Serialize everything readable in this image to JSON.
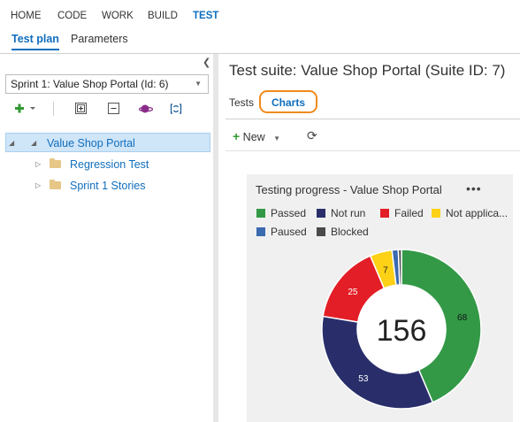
{
  "topnav": [
    "HOME",
    "CODE",
    "WORK",
    "BUILD",
    "TEST"
  ],
  "subnav": [
    "Test plan",
    "Parameters"
  ],
  "left": {
    "plan_select": "Sprint 1: Value Shop Portal (Id: 6)",
    "tree": [
      {
        "label": "Value Shop Portal"
      },
      {
        "label": "Regression Test"
      },
      {
        "label": "Sprint 1 Stories"
      }
    ]
  },
  "main": {
    "title": "Test suite: Value Shop Portal (Suite ID: 7)",
    "tabs": [
      "Tests",
      "Charts"
    ],
    "toolbar": {
      "new_label": "New"
    }
  },
  "chart": {
    "title": "Testing progress - Value Shop Portal",
    "more": "•••",
    "legend": [
      "Passed",
      "Not run",
      "Failed",
      "Not applica...",
      "Paused",
      "Blocked"
    ],
    "center_total": "156"
  },
  "chart_data": {
    "type": "pie",
    "title": "Testing progress - Value Shop Portal",
    "categories": [
      "Passed",
      "Not run",
      "Failed",
      "Not applicable",
      "Paused",
      "Blocked"
    ],
    "values": [
      68,
      53,
      25,
      7,
      2,
      1
    ],
    "colors": [
      "#339947",
      "#292e6b",
      "#e31e26",
      "#fcd116",
      "#3a6ab0",
      "#4a4a4a"
    ],
    "total": 156,
    "donut": true,
    "legend_position": "top"
  }
}
